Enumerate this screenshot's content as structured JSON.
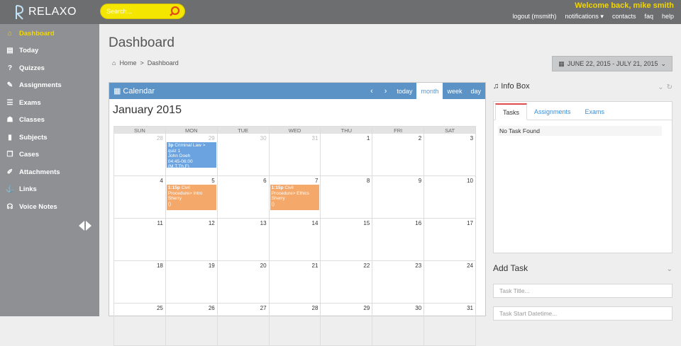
{
  "app": {
    "name": "RELAXO",
    "brand_yellow": "#f2d600",
    "topbar_color": "#6d6e70",
    "sidebar_color": "#8e9093",
    "accent_blue": "#5b93c7"
  },
  "search": {
    "placeholder": "Search..."
  },
  "header": {
    "welcome": "Welcome back, mike smith",
    "nav": [
      {
        "label": "logout (msmith)"
      },
      {
        "label": "notifications ▾"
      },
      {
        "label": "contacts"
      },
      {
        "label": "faq"
      },
      {
        "label": "help"
      }
    ]
  },
  "sidebar": {
    "items": [
      {
        "label": "Dashboard",
        "icon": "home-icon",
        "glyph": "⌂",
        "active": true
      },
      {
        "label": "Today",
        "icon": "list-icon",
        "glyph": "▤",
        "active": false
      },
      {
        "label": "Quizzes",
        "icon": "question-icon",
        "glyph": "?",
        "active": false
      },
      {
        "label": "Assignments",
        "icon": "edit-icon",
        "glyph": "✎",
        "active": false
      },
      {
        "label": "Exams",
        "icon": "checklist-icon",
        "glyph": "☰",
        "active": false
      },
      {
        "label": "Classes",
        "icon": "group-icon",
        "glyph": "☗",
        "active": false
      },
      {
        "label": "Subjects",
        "icon": "book-icon",
        "glyph": "▮",
        "active": false
      },
      {
        "label": "Cases",
        "icon": "copy-icon",
        "glyph": "❐",
        "active": false
      },
      {
        "label": "Attachments",
        "icon": "paperclip-icon",
        "glyph": "✐",
        "active": false
      },
      {
        "label": "Links",
        "icon": "anchor-icon",
        "glyph": "⚓",
        "active": false
      },
      {
        "label": "Voice Notes",
        "icon": "headphones-icon",
        "glyph": "☊",
        "active": false
      }
    ]
  },
  "page": {
    "title": "Dashboard",
    "breadcrumb": {
      "home": "Home",
      "separator": ">",
      "current": "Dashboard"
    },
    "daterange": "JUNE 22, 2015 - JULY 21, 2015"
  },
  "calendar": {
    "title": "Calendar",
    "controls": {
      "prev": "‹",
      "next": "›",
      "today": "today",
      "month": "month",
      "week": "week",
      "day": "day"
    },
    "month_title": "January 2015",
    "dow": [
      "SUN",
      "MON",
      "TUE",
      "WED",
      "THU",
      "FRI",
      "SAT"
    ],
    "weeks": [
      [
        {
          "n": "28",
          "o": true
        },
        {
          "n": "29",
          "o": true
        },
        {
          "n": "30",
          "o": true
        },
        {
          "n": "31",
          "o": true
        },
        {
          "n": "1"
        },
        {
          "n": "2"
        },
        {
          "n": "3"
        }
      ],
      [
        {
          "n": "4"
        },
        {
          "n": "5"
        },
        {
          "n": "6"
        },
        {
          "n": "7"
        },
        {
          "n": "8"
        },
        {
          "n": "9"
        },
        {
          "n": "10"
        }
      ],
      [
        {
          "n": "11"
        },
        {
          "n": "12"
        },
        {
          "n": "13"
        },
        {
          "n": "14"
        },
        {
          "n": "15"
        },
        {
          "n": "16"
        },
        {
          "n": "17"
        }
      ],
      [
        {
          "n": "18"
        },
        {
          "n": "19"
        },
        {
          "n": "20"
        },
        {
          "n": "21"
        },
        {
          "n": "22"
        },
        {
          "n": "23"
        },
        {
          "n": "24"
        }
      ],
      [
        {
          "n": "25"
        },
        {
          "n": "26"
        },
        {
          "n": "27"
        },
        {
          "n": "28"
        },
        {
          "n": "29"
        },
        {
          "n": "30"
        },
        {
          "n": "31"
        }
      ]
    ],
    "events": [
      {
        "week": 0,
        "day": 1,
        "color": "blue",
        "time": "3p",
        "text": "Criminal Law > quiz 1",
        "line2": "John Doeh",
        "line3": "04:45-06:00 (M,T,Th,F)"
      },
      {
        "week": 1,
        "day": 1,
        "color": "orange",
        "time": "1:15p",
        "text": "Civil Procedure> Intro",
        "line2": "Sherry",
        "line3": "()"
      },
      {
        "week": 1,
        "day": 3,
        "color": "orange",
        "time": "1:15p",
        "text": "Civil Procedure> Ethics",
        "line2": "Sherry",
        "line3": "()"
      }
    ]
  },
  "info_box": {
    "title": "Info Box",
    "tabs": [
      {
        "label": "Tasks",
        "active": true
      },
      {
        "label": "Assignments",
        "active": false
      },
      {
        "label": "Exams",
        "active": false
      }
    ],
    "empty_text": "No Task Found"
  },
  "add_task": {
    "title": "Add Task",
    "title_placeholder": "Task Title...",
    "start_placeholder": "Task Start Datetime..."
  }
}
